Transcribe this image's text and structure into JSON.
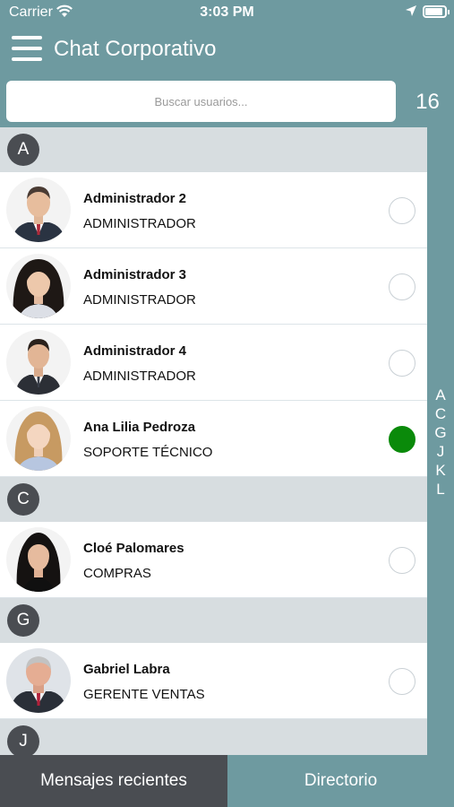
{
  "status_bar": {
    "carrier": "Carrier",
    "time": "3:03 PM"
  },
  "header": {
    "title": "Chat Corporativo"
  },
  "search": {
    "placeholder": "Buscar usuarios..."
  },
  "user_count": "16",
  "sections": [
    {
      "letter": "A",
      "contacts": [
        {
          "name": "Administrador 2",
          "role": "ADMINISTRADOR",
          "selected": false
        },
        {
          "name": "Administrador 3",
          "role": "ADMINISTRADOR",
          "selected": false
        },
        {
          "name": "Administrador 4",
          "role": "ADMINISTRADOR",
          "selected": false
        },
        {
          "name": "Ana Lilia Pedroza",
          "role": "SOPORTE TÉCNICO",
          "selected": true
        }
      ]
    },
    {
      "letter": "C",
      "contacts": [
        {
          "name": "Cloé Palomares",
          "role": "COMPRAS",
          "selected": false
        }
      ]
    },
    {
      "letter": "G",
      "contacts": [
        {
          "name": "Gabriel Labra",
          "role": "GERENTE VENTAS",
          "selected": false
        }
      ]
    },
    {
      "letter": "J",
      "contacts": []
    }
  ],
  "index_letters": [
    "A",
    "C",
    "G",
    "J",
    "K",
    "L"
  ],
  "tabs": {
    "recent": "Mensajes recientes",
    "directory": "Directorio"
  },
  "colors": {
    "teal": "#6e9aa0",
    "dark": "#4a4d52",
    "selected_green": "#0a8a0a",
    "section_bg": "#d7dde0"
  }
}
